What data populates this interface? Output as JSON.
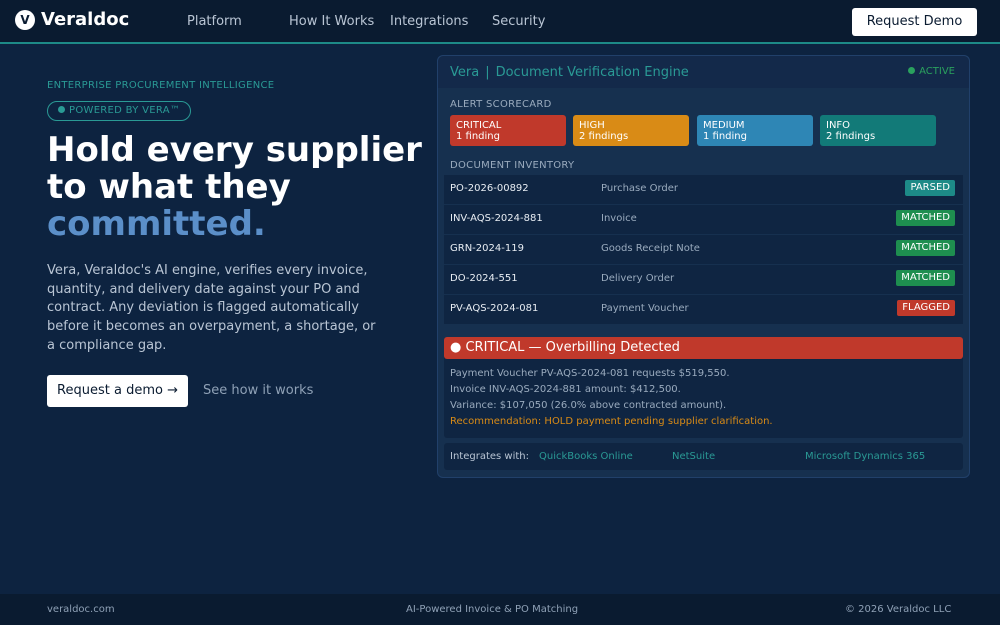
{
  "nav": {
    "brand": "Veraldoc",
    "logo_letter": "V",
    "links": [
      "Platform",
      "How It Works",
      "Integrations",
      "Security"
    ],
    "cta": "Request Demo"
  },
  "hero": {
    "eyebrow": "ENTERPRISE PROCUREMENT INTELLIGENCE",
    "pill": "POWERED BY VERA™",
    "headline_lines": [
      "Hold every supplier",
      "to what they"
    ],
    "headline_accent": "committed.",
    "body": "Vera, Veraldoc's AI engine, verifies every invoice, quantity, and delivery date against your PO and contract. Any deviation is flagged automatically before it becomes an overpayment, a shortage, or a compliance gap.",
    "primary_cta": "Request a demo →",
    "secondary_cta": "See how it works"
  },
  "panel": {
    "title_name": "Vera",
    "title_sep": "|",
    "title_sub": "Document Verification Engine",
    "status": "ACTIVE",
    "scorecard_label": "ALERT SCORECARD",
    "scorecard": [
      {
        "level": "CRITICAL",
        "count": "1 finding",
        "color": "#c0392b"
      },
      {
        "level": "HIGH",
        "count": "2 findings",
        "color": "#d98b16"
      },
      {
        "level": "MEDIUM",
        "count": "1 finding",
        "color": "#2e86b5"
      },
      {
        "level": "INFO",
        "count": "2 findings",
        "color": "#127a78"
      }
    ],
    "inventory_label": "DOCUMENT INVENTORY",
    "inventory": [
      {
        "id": "PO-2026-00892",
        "type": "Purchase Order",
        "status": "PARSED",
        "color": "#1d8a87"
      },
      {
        "id": "INV-AQS-2024-881",
        "type": "Invoice",
        "status": "MATCHED",
        "color": "#1e8e4f"
      },
      {
        "id": "GRN-2024-119",
        "type": "Goods Receipt Note",
        "status": "MATCHED",
        "color": "#1e8e4f"
      },
      {
        "id": "DO-2024-551",
        "type": "Delivery Order",
        "status": "MATCHED",
        "color": "#1e8e4f"
      },
      {
        "id": "PV-AQS-2024-081",
        "type": "Payment Voucher",
        "status": "FLAGGED",
        "color": "#c0392b"
      }
    ],
    "alert": {
      "title": "● CRITICAL — Overbilling Detected",
      "lines": [
        "Payment Voucher PV-AQS-2024-081 requests $519,550.",
        "Invoice INV-AQS-2024-881 amount: $412,500.",
        "Variance: $107,050 (26.0% above contracted amount)."
      ],
      "recommendation": "Recommendation: HOLD payment pending supplier clarification."
    },
    "integrations_label": "Integrates with:",
    "integrations": [
      "QuickBooks Online",
      "NetSuite",
      "Microsoft Dynamics 365"
    ]
  },
  "footer": {
    "left": "veraldoc.com",
    "center": "AI-Powered Invoice & PO Matching",
    "right": "© 2026 Veraldoc LLC"
  }
}
